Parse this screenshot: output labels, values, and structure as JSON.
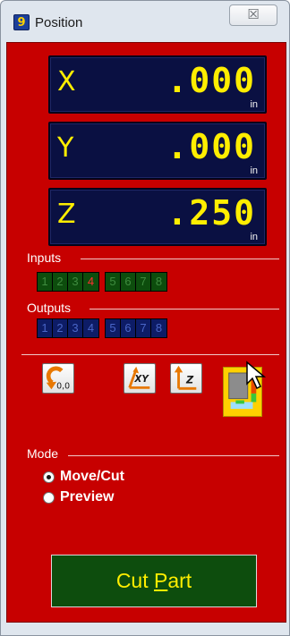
{
  "window": {
    "title": "Position",
    "close_glyph": "☒"
  },
  "dro": {
    "x": {
      "axis": "X",
      "value": ".000",
      "unit": "in"
    },
    "y": {
      "axis": "Y",
      "value": ".000",
      "unit": "in"
    },
    "z": {
      "axis": "Z",
      "value": ".250",
      "unit": "in"
    }
  },
  "inputs": {
    "label": "Inputs",
    "group1": [
      "1",
      "2",
      "3",
      "4"
    ],
    "group2": [
      "5",
      "6",
      "7",
      "8"
    ],
    "active": [
      "4"
    ]
  },
  "outputs": {
    "label": "Outputs",
    "group1": [
      "1",
      "2",
      "3",
      "4"
    ],
    "group2": [
      "5",
      "6",
      "7",
      "8"
    ]
  },
  "tools": {
    "home_label": "0,0",
    "xy_label": "XY",
    "z_label": "Z"
  },
  "mode": {
    "label": "Mode",
    "options": [
      {
        "label": "Move/Cut",
        "checked": true
      },
      {
        "label": "Preview",
        "checked": false
      }
    ]
  },
  "cut_part": {
    "prefix": "Cut ",
    "mnemonic": "P",
    "suffix": "art"
  },
  "colors": {
    "panel": "#c70000",
    "dro_bg": "#0a1042",
    "dro_text": "#ffee00",
    "input_bg": "#0d4d0d",
    "output_bg": "#0d1c66"
  }
}
